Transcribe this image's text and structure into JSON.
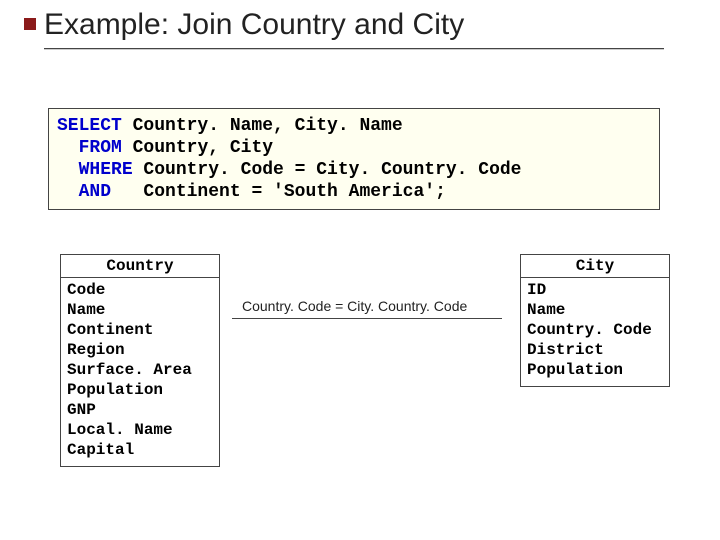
{
  "title": "Example: Join Country and City",
  "sql": {
    "kw_select": "SELECT",
    "select_list": " Country. Name, City. Name",
    "kw_from": "FROM",
    "from_list": " Country, City",
    "kw_where": "WHERE",
    "where_clause": " Country. Code = City. Country. Code",
    "kw_and": "AND",
    "and_clause": "   Continent = 'South America';"
  },
  "join_condition": "Country. Code = City. Country. Code",
  "tables": {
    "country": {
      "name": "Country",
      "cols": [
        "Code",
        "Name",
        "Continent",
        "Region",
        "Surface. Area",
        "Population",
        "GNP",
        "Local. Name",
        "Capital"
      ]
    },
    "city": {
      "name": "City",
      "cols": [
        "ID",
        "Name",
        "Country. Code",
        "District",
        "Population"
      ]
    }
  }
}
